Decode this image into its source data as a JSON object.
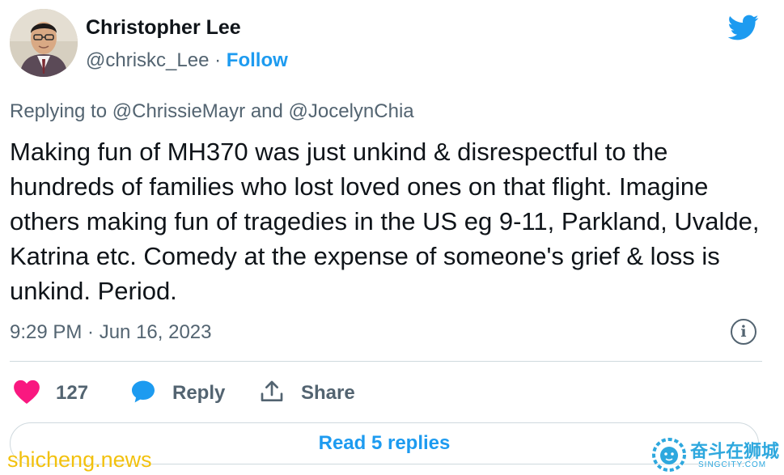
{
  "author": {
    "name": "Christopher Lee",
    "handle": "@chriskc_Lee",
    "separator": "·",
    "follow_label": "Follow"
  },
  "platform_icon": "twitter-bird-icon",
  "tweet": {
    "replying_prefix": "Replying to",
    "replying_user_1": "@ChrissieMayr",
    "replying_conjunction": "and",
    "replying_user_2": "@JocelynChia",
    "text": "Making fun of MH370 was just unkind & disrespectful to the hundreds of families who lost loved ones on that flight. Imagine others making fun of tragedies in the US eg 9-11, Parkland, Uvalde, Katrina etc. Comedy at the expense of someone's grief & loss is unkind. Period.",
    "timestamp": "9:29 PM · Jun 16, 2023",
    "info_icon": "info-icon"
  },
  "actions": {
    "like_count": "127",
    "reply_label": "Reply",
    "share_label": "Share"
  },
  "read_replies_label": "Read 5 replies",
  "watermarks": {
    "left": "shicheng.news",
    "right_title": "奋斗在狮城",
    "right_sub": "SINGCITY.COM"
  },
  "colors": {
    "twitter_blue": "#1d9bf0",
    "like_pink": "#f91880",
    "text_primary": "#0f1419",
    "text_secondary": "#536471"
  }
}
